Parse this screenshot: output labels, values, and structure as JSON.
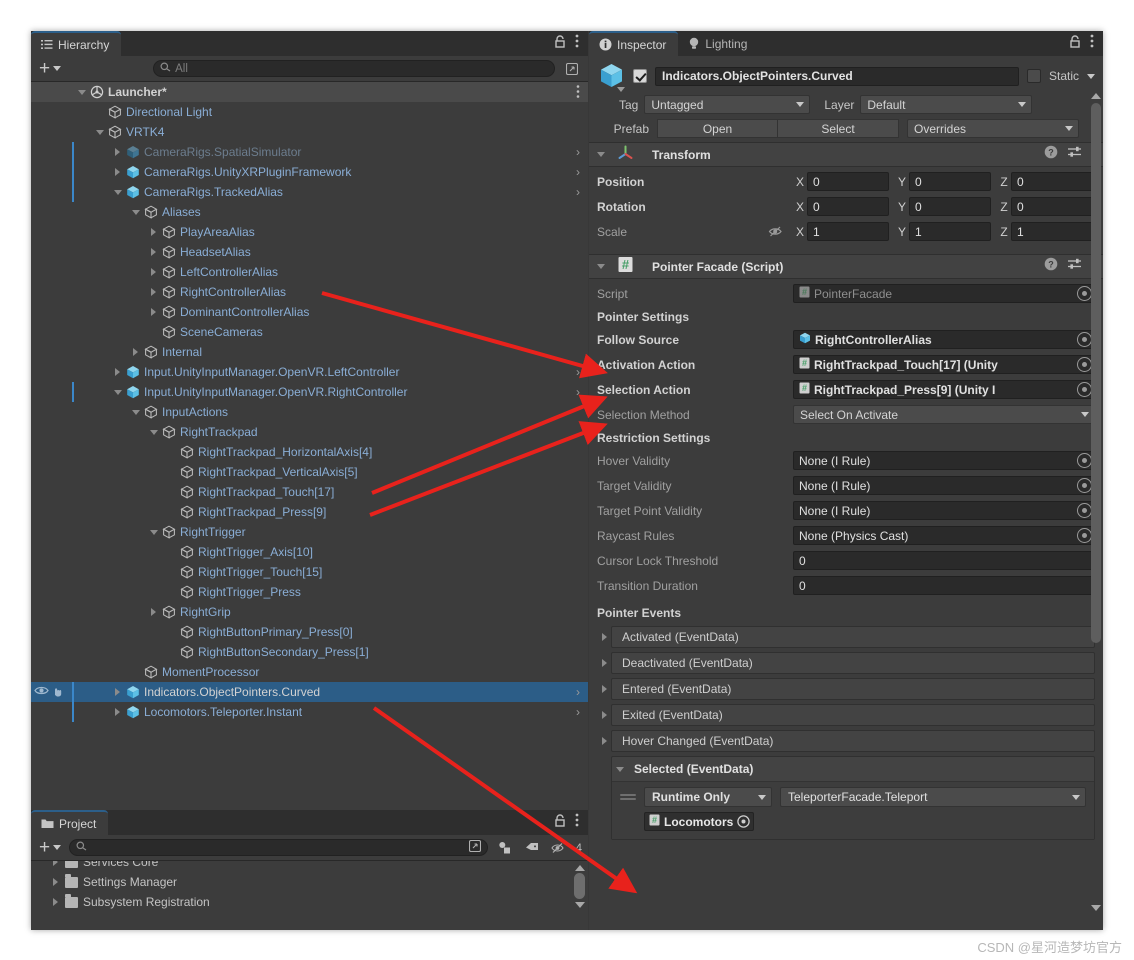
{
  "hierarchy": {
    "tab_label": "Hierarchy",
    "search_placeholder": "All",
    "rows": [
      {
        "label": "Launcher*",
        "depth": 1,
        "twisty": "down",
        "icon": "unity-scene-icon",
        "color": "white",
        "kebab": true
      },
      {
        "label": "Directional Light",
        "depth": 2,
        "twisty": "none",
        "icon": "gameobject-icon",
        "color": "plain"
      },
      {
        "label": "VRTK4",
        "depth": 2,
        "twisty": "down",
        "icon": "gameobject-icon",
        "color": "plain"
      },
      {
        "label": "CameraRigs.SpatialSimulator",
        "depth": 3,
        "twisty": "right",
        "icon": "prefab-icon",
        "color": "dim",
        "chevron": true,
        "vline": true
      },
      {
        "label": "CameraRigs.UnityXRPluginFramework",
        "depth": 3,
        "twisty": "right",
        "icon": "prefab-icon",
        "color": "prefab",
        "chevron": true,
        "vline": true
      },
      {
        "label": "CameraRigs.TrackedAlias",
        "depth": 3,
        "twisty": "down",
        "icon": "prefab-icon",
        "color": "prefab",
        "chevron": true,
        "vline": true
      },
      {
        "label": "Aliases",
        "depth": 4,
        "twisty": "down",
        "icon": "gameobject-icon",
        "color": "plain"
      },
      {
        "label": "PlayAreaAlias",
        "depth": 5,
        "twisty": "right",
        "icon": "gameobject-icon",
        "color": "plain"
      },
      {
        "label": "HeadsetAlias",
        "depth": 5,
        "twisty": "right",
        "icon": "gameobject-icon",
        "color": "plain"
      },
      {
        "label": "LeftControllerAlias",
        "depth": 5,
        "twisty": "right",
        "icon": "gameobject-icon",
        "color": "plain"
      },
      {
        "label": "RightControllerAlias",
        "depth": 5,
        "twisty": "right",
        "icon": "gameobject-icon",
        "color": "plain"
      },
      {
        "label": "DominantControllerAlias",
        "depth": 5,
        "twisty": "right",
        "icon": "gameobject-icon",
        "color": "plain"
      },
      {
        "label": "SceneCameras",
        "depth": 5,
        "twisty": "none",
        "icon": "gameobject-icon",
        "color": "plain"
      },
      {
        "label": "Internal",
        "depth": 4,
        "twisty": "right",
        "icon": "gameobject-icon",
        "color": "plain"
      },
      {
        "label": "Input.UnityInputManager.OpenVR.LeftController",
        "depth": 3,
        "twisty": "right",
        "icon": "prefab-icon",
        "color": "prefab",
        "chevron": true
      },
      {
        "label": "Input.UnityInputManager.OpenVR.RightController",
        "depth": 3,
        "twisty": "down",
        "icon": "prefab-icon",
        "color": "prefab",
        "chevron": true,
        "vline": true
      },
      {
        "label": "InputActions",
        "depth": 4,
        "twisty": "down",
        "icon": "gameobject-icon",
        "color": "plain"
      },
      {
        "label": "RightTrackpad",
        "depth": 5,
        "twisty": "down",
        "icon": "gameobject-icon",
        "color": "plain"
      },
      {
        "label": "RightTrackpad_HorizontalAxis[4]",
        "depth": 6,
        "twisty": "none",
        "icon": "gameobject-icon",
        "color": "plain"
      },
      {
        "label": "RightTrackpad_VerticalAxis[5]",
        "depth": 6,
        "twisty": "none",
        "icon": "gameobject-icon",
        "color": "plain"
      },
      {
        "label": "RightTrackpad_Touch[17]",
        "depth": 6,
        "twisty": "none",
        "icon": "gameobject-icon",
        "color": "plain"
      },
      {
        "label": "RightTrackpad_Press[9]",
        "depth": 6,
        "twisty": "none",
        "icon": "gameobject-icon",
        "color": "plain"
      },
      {
        "label": "RightTrigger",
        "depth": 5,
        "twisty": "down",
        "icon": "gameobject-icon",
        "color": "plain"
      },
      {
        "label": "RightTrigger_Axis[10]",
        "depth": 6,
        "twisty": "none",
        "icon": "gameobject-icon",
        "color": "plain"
      },
      {
        "label": "RightTrigger_Touch[15]",
        "depth": 6,
        "twisty": "none",
        "icon": "gameobject-icon",
        "color": "plain"
      },
      {
        "label": "RightTrigger_Press",
        "depth": 6,
        "twisty": "none",
        "icon": "gameobject-icon",
        "color": "plain"
      },
      {
        "label": "RightGrip",
        "depth": 5,
        "twisty": "right",
        "icon": "gameobject-icon",
        "color": "plain"
      },
      {
        "label": "RightButtonPrimary_Press[0]",
        "depth": 6,
        "twisty": "none",
        "icon": "gameobject-icon",
        "color": "plain"
      },
      {
        "label": "RightButtonSecondary_Press[1]",
        "depth": 6,
        "twisty": "none",
        "icon": "gameobject-icon",
        "color": "plain"
      },
      {
        "label": "MomentProcessor",
        "depth": 4,
        "twisty": "none",
        "icon": "gameobject-icon",
        "color": "plain"
      },
      {
        "label": "Indicators.ObjectPointers.Curved",
        "depth": 3,
        "twisty": "right",
        "icon": "prefab-icon",
        "color": "white",
        "chevron": true,
        "selected": true,
        "gutter": true,
        "vline": true
      },
      {
        "label": "Locomotors.Teleporter.Instant",
        "depth": 3,
        "twisty": "right",
        "icon": "prefab-icon",
        "color": "prefab",
        "chevron": true,
        "vline": true
      }
    ]
  },
  "project": {
    "tab_label": "Project",
    "search_placeholder": "",
    "rows": [
      {
        "label": "Services Core"
      },
      {
        "label": "Settings Manager"
      },
      {
        "label": "Subsystem Registration"
      }
    ],
    "toolbar_icons": [
      "save-search-icon",
      "object-filter-icon",
      "label-filter-icon",
      "hidden-packages-icon"
    ],
    "hidden_count": "4"
  },
  "inspector": {
    "tab_label": "Inspector",
    "tab2_label": "Lighting",
    "object_name": "Indicators.ObjectPointers.Curved",
    "static_label": "Static",
    "tag_label": "Tag",
    "tag_value": "Untagged",
    "layer_label": "Layer",
    "layer_value": "Default",
    "prefab_label": "Prefab",
    "prefab_open": "Open",
    "prefab_select": "Select",
    "prefab_overrides": "Overrides",
    "transform": {
      "title": "Transform",
      "rows": [
        {
          "label": "Position",
          "x": "0",
          "y": "0",
          "z": "0",
          "dim": false,
          "eye": false
        },
        {
          "label": "Rotation",
          "x": "0",
          "y": "0",
          "z": "0",
          "dim": false,
          "eye": false
        },
        {
          "label": "Scale",
          "x": "1",
          "y": "1",
          "z": "1",
          "dim": true,
          "eye": true
        }
      ],
      "axes": [
        "X",
        "Y",
        "Z"
      ]
    },
    "pointer_facade": {
      "title": "Pointer Facade (Script)",
      "script_label": "Script",
      "script_value": "PointerFacade",
      "pointer_settings_title": "Pointer Settings",
      "follow_source_label": "Follow Source",
      "follow_source_value": "RightControllerAlias",
      "activation_action_label": "Activation Action",
      "activation_action_value": "RightTrackpad_Touch[17] (Unity",
      "selection_action_label": "Selection Action",
      "selection_action_value": "RightTrackpad_Press[9] (Unity I",
      "selection_method_label": "Selection Method",
      "selection_method_value": "Select On Activate",
      "restriction_settings_title": "Restriction Settings",
      "restrictions": [
        {
          "label": "Hover Validity",
          "value": "None (I Rule)",
          "type": "object"
        },
        {
          "label": "Target Validity",
          "value": "None (I Rule)",
          "type": "object"
        },
        {
          "label": "Target Point Validity",
          "value": "None (I Rule)",
          "type": "object"
        },
        {
          "label": "Raycast Rules",
          "value": "None (Physics Cast)",
          "type": "object"
        },
        {
          "label": "Cursor Lock Threshold",
          "value": "0",
          "type": "number"
        },
        {
          "label": "Transition Duration",
          "value": "0",
          "type": "number"
        }
      ],
      "pointer_events_title": "Pointer Events",
      "events": [
        {
          "label": "Activated (EventData)"
        },
        {
          "label": "Deactivated (EventData)"
        },
        {
          "label": "Entered (EventData)"
        },
        {
          "label": "Exited (EventData)"
        },
        {
          "label": "Hover Changed (EventData)"
        }
      ],
      "selected_event": {
        "label": "Selected (EventData)",
        "runtime_mode": "Runtime Only",
        "function": "TeleporterFacade.Teleport",
        "object": "Locomotors"
      }
    }
  },
  "watermark": "CSDN @星河造梦坊官方",
  "colors": {
    "selection_blue": "#2c5d87",
    "accent_blue": "#3b87c9",
    "panel_bg": "#3c3c3c",
    "tab_bg": "#2e2e2e",
    "arrow_red": "#e8221c"
  }
}
